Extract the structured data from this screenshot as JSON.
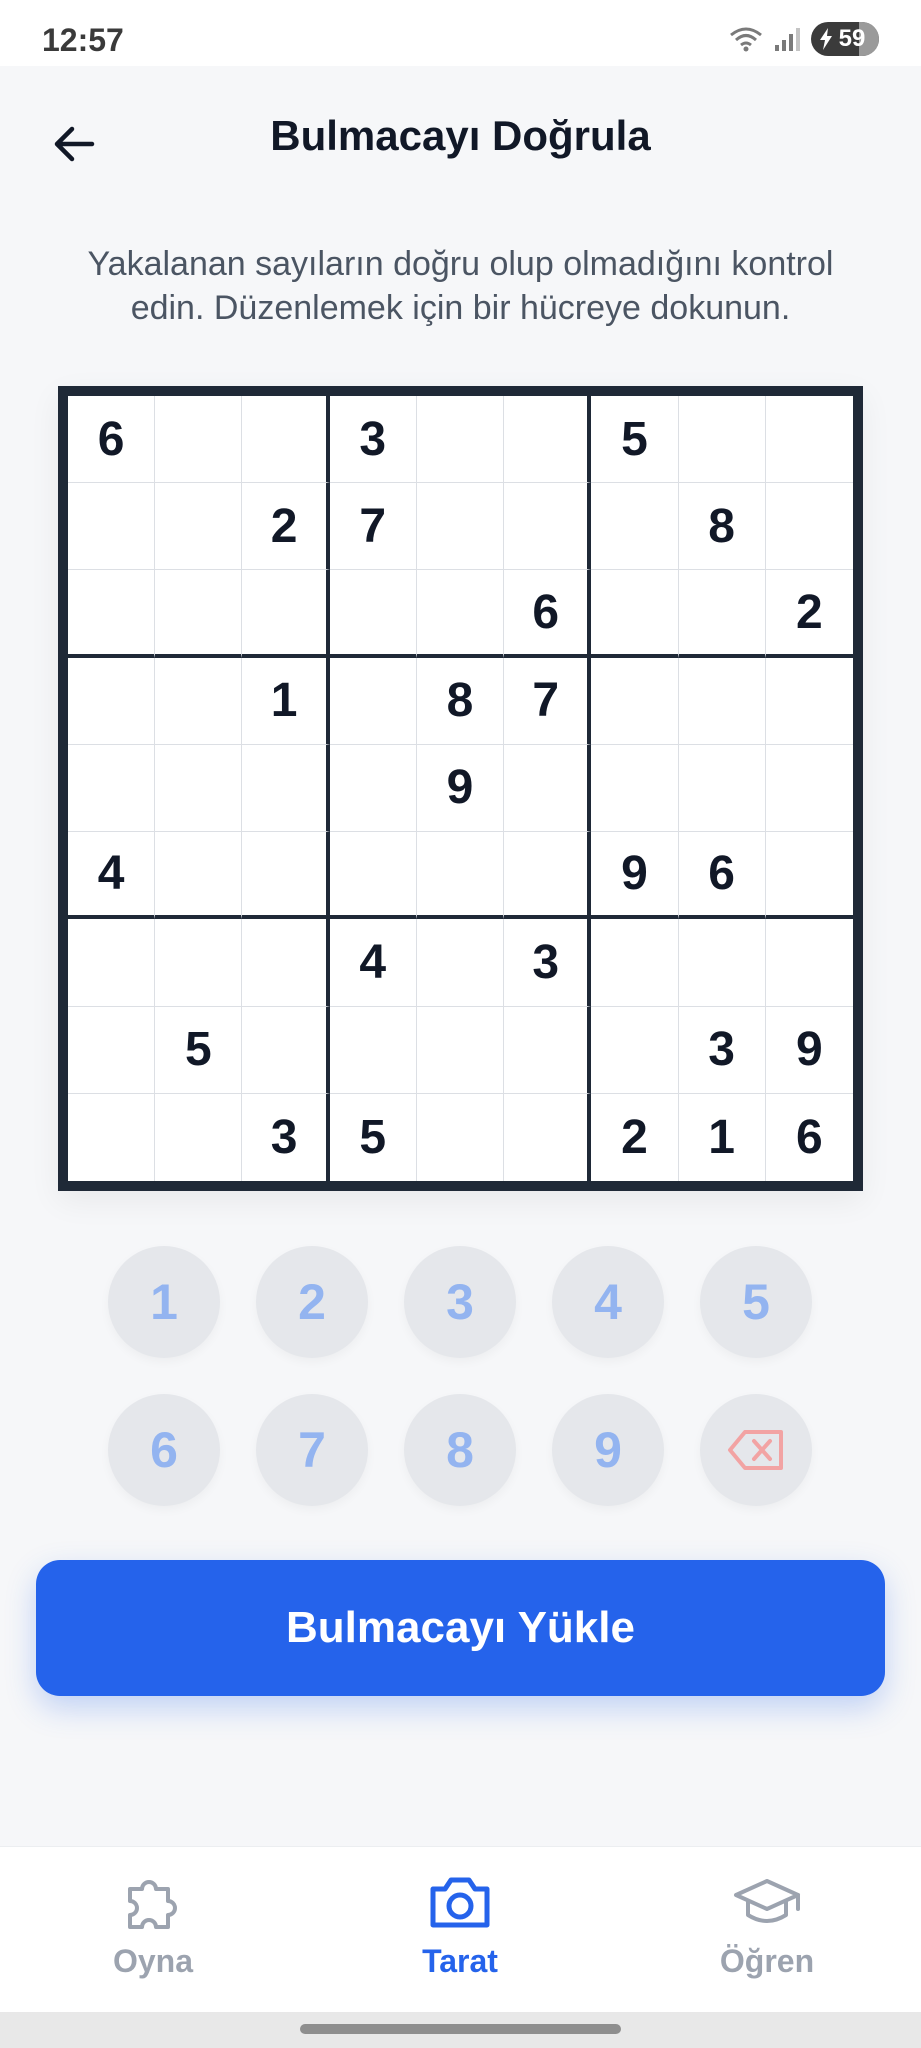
{
  "status_bar": {
    "time": "12:57",
    "battery": "59"
  },
  "header": {
    "title": "Bulmacayı Doğrula"
  },
  "description": "Yakalanan sayıların doğru olup olmadığını kontrol edin. Düzenlemek için bir hücreye dokunun.",
  "board": [
    [
      "6",
      "",
      "",
      "3",
      "",
      "",
      "5",
      "",
      ""
    ],
    [
      "",
      "",
      "2",
      "7",
      "",
      "",
      "",
      "8",
      ""
    ],
    [
      "",
      "",
      "",
      "",
      "",
      "6",
      "",
      "",
      "2"
    ],
    [
      "",
      "",
      "1",
      "",
      "8",
      "7",
      "",
      "",
      ""
    ],
    [
      "",
      "",
      "",
      "",
      "9",
      "",
      "",
      "",
      ""
    ],
    [
      "4",
      "",
      "",
      "",
      "",
      "",
      "9",
      "6",
      ""
    ],
    [
      "",
      "",
      "",
      "4",
      "",
      "3",
      "",
      "",
      ""
    ],
    [
      "",
      "5",
      "",
      "",
      "",
      "",
      "",
      "3",
      "9"
    ],
    [
      "",
      "",
      "3",
      "5",
      "",
      "",
      "2",
      "1",
      "6"
    ]
  ],
  "keypad": {
    "digits": [
      "1",
      "2",
      "3",
      "4",
      "5",
      "6",
      "7",
      "8",
      "9"
    ],
    "delete_icon": "backspace-icon"
  },
  "primary_button": "Bulmacayı Yükle",
  "bottom_nav": [
    {
      "label": "Oyna",
      "icon": "puzzle-icon",
      "active": false
    },
    {
      "label": "Tarat",
      "icon": "camera-icon",
      "active": true
    },
    {
      "label": "Öğren",
      "icon": "graduation-cap-icon",
      "active": false
    }
  ],
  "colors": {
    "accent": "#2563eb",
    "board_border": "#1f2937",
    "keypad_digit": "#93b4f0",
    "delete": "#f2a3a3"
  }
}
